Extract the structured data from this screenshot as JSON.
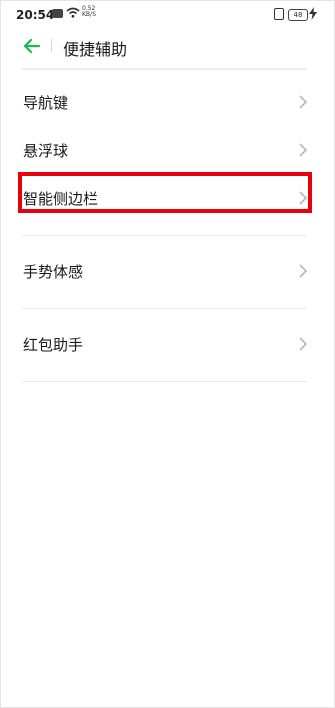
{
  "status_bar": {
    "time": "20:54",
    "speed_value": "0.52",
    "speed_unit": "KB/S",
    "battery": "48"
  },
  "header": {
    "title": "便捷辅助",
    "back_icon": "back-arrow-icon",
    "accent_color": "#1db954"
  },
  "items": [
    {
      "label": "导航键"
    },
    {
      "label": "悬浮球"
    },
    {
      "label": "智能侧边栏"
    },
    {
      "label": "手势体感"
    },
    {
      "label": "红包助手"
    }
  ],
  "highlight_color": "#e8000b"
}
